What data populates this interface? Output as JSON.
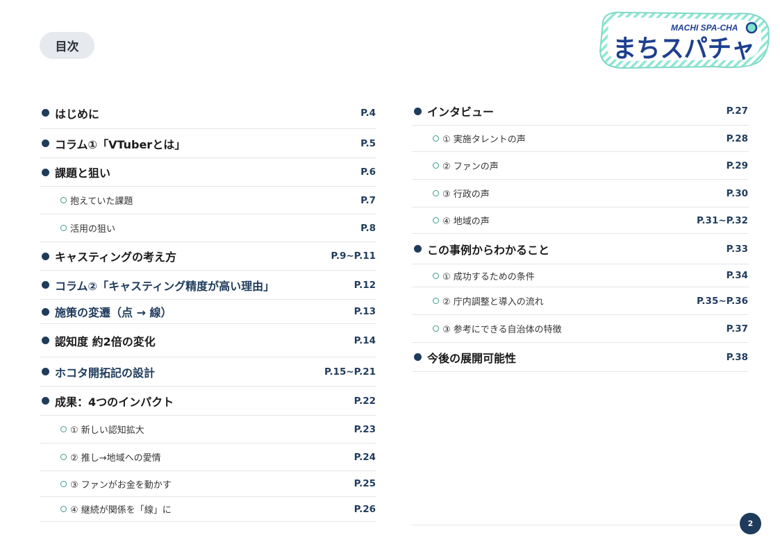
{
  "header": {
    "toc_label": "目次"
  },
  "logo": {
    "sub": "MACHI SPA-CHA",
    "main": "まちスパチャ"
  },
  "left_items": [
    {
      "title": "はじめに",
      "page": "P.4",
      "level": 1,
      "h": 46
    },
    {
      "title": "コラム①「VTuberとは」",
      "page": "P.5",
      "level": 1,
      "h": 42
    },
    {
      "title": "課題と狙い",
      "page": "P.6",
      "level": 1,
      "h": 41
    },
    {
      "title": "抱えていた課題",
      "page": "P.7",
      "level": 2,
      "h": 40
    },
    {
      "title": "活用の狙い",
      "page": "P.8",
      "level": 2,
      "h": 40
    },
    {
      "title": "キャスティングの考え方",
      "page": "P.9~P.11",
      "level": 1,
      "h": 41
    },
    {
      "title": "コラム②「キャスティング精度が高い理由」",
      "page": "P.12",
      "level": 1,
      "h": 42,
      "blue": true
    },
    {
      "title": "施策の変遷（点 → 線）",
      "page": "P.13",
      "level": 1,
      "h": 35,
      "blue": true
    },
    {
      "title": "認知度 約2倍の変化",
      "page": "P.14",
      "level": 1,
      "h": 48
    },
    {
      "title": "ホコタ開拓記の設計",
      "page": "P.15~P.21",
      "level": 1,
      "h": 42,
      "blue": true
    },
    {
      "title": "成果：4つのインパクト",
      "page": "P.22",
      "level": 1,
      "h": 42
    },
    {
      "title": "① 新しい認知拡大",
      "page": "P.23",
      "level": 2,
      "h": 40
    },
    {
      "title": "② 推し→地域への愛情",
      "page": "P.24",
      "level": 2,
      "h": 40
    },
    {
      "title": "③ ファンがお金を動かす",
      "page": "P.25",
      "level": 2,
      "h": 37
    },
    {
      "title": "④ 継続が関係を「線」に",
      "page": "P.26",
      "level": 2,
      "h": 36
    }
  ],
  "right_items": [
    {
      "title": "インタビュー",
      "page": "P.27",
      "level": 1,
      "h": 41
    },
    {
      "title": "① 実施タレントの声",
      "page": "P.28",
      "level": 2,
      "h": 38
    },
    {
      "title": "② ファンの声",
      "page": "P.29",
      "level": 2,
      "h": 40
    },
    {
      "title": "③ 行政の声",
      "page": "P.30",
      "level": 2,
      "h": 40
    },
    {
      "title": "④ 地域の声",
      "page": "P.31~P.32",
      "level": 2,
      "h": 38
    },
    {
      "title": "この事例からわかること",
      "page": "P.33",
      "level": 1,
      "h": 44
    },
    {
      "title": "① 成功するための条件",
      "page": "P.34",
      "level": 2,
      "h": 33
    },
    {
      "title": "② 庁内調整と導入の流れ",
      "page": "P.35~P.36",
      "level": 2,
      "h": 40
    },
    {
      "title": "③ 参考にできる自治体の特徴",
      "page": "P.37",
      "level": 2,
      "h": 40
    },
    {
      "title": "今後の展開可能性",
      "page": "P.38",
      "level": 1,
      "h": 42
    }
  ],
  "footer": {
    "page_number": "2"
  },
  "colors": {
    "navy": "#1f3b5c",
    "teal": "#3a9a8c",
    "logo_blue": "#1d3f8f",
    "logo_mint": "#7fe3cf"
  }
}
